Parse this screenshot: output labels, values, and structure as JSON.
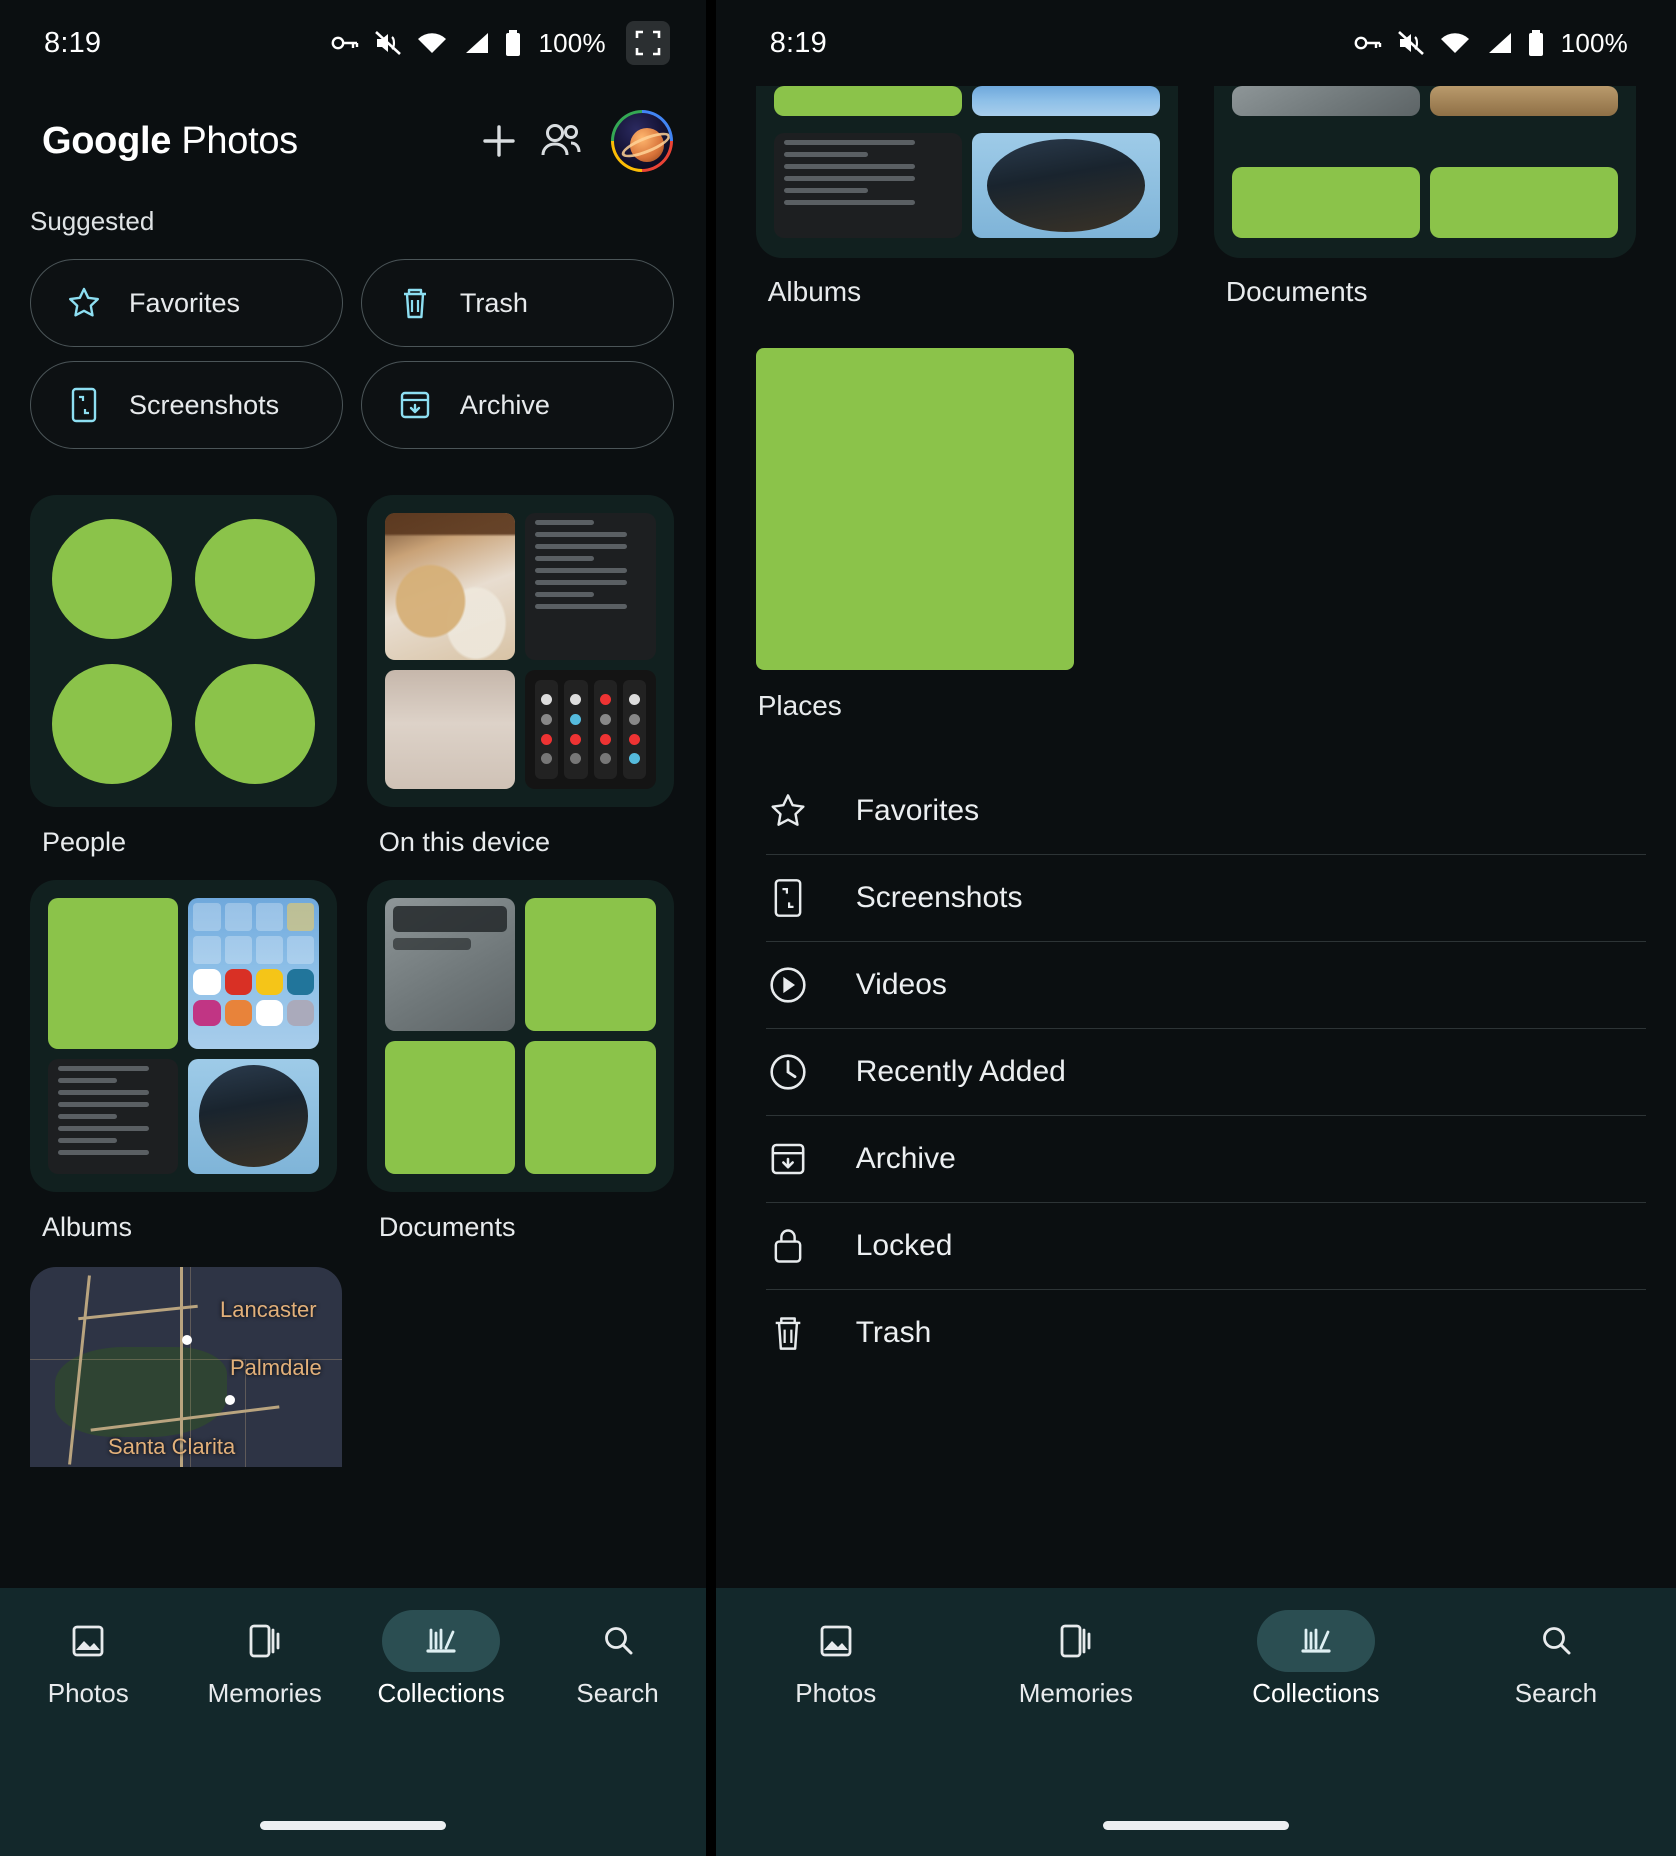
{
  "left": {
    "status": {
      "time": "8:19",
      "battery_pct": "100%",
      "icons": [
        "key-icon",
        "mute-icon",
        "wifi-icon",
        "signal-icon",
        "battery-icon"
      ],
      "fullscreen_icon": "fullscreen-icon"
    },
    "appbar": {
      "brand_bold": "Google",
      "brand_thin": " Photos",
      "add_icon": "plus-icon",
      "sharing_icon": "people-icon",
      "avatar_icon": "account-avatar"
    },
    "suggested": {
      "label": "Suggested",
      "chips": [
        {
          "label": "Favorites",
          "icon": "star-icon"
        },
        {
          "label": "Trash",
          "icon": "trash-icon"
        },
        {
          "label": "Screenshots",
          "icon": "screenshot-icon"
        },
        {
          "label": "Archive",
          "icon": "archive-icon"
        }
      ]
    },
    "tiles": [
      {
        "caption": "People",
        "kind": "people"
      },
      {
        "caption": "On this device",
        "kind": "device"
      },
      {
        "caption": "Albums",
        "kind": "albums"
      },
      {
        "caption": "Documents",
        "kind": "documents"
      }
    ],
    "map": {
      "labels": [
        "Lancaster",
        "Palmdale",
        "Santa Clarita"
      ]
    },
    "bottomnav": {
      "items": [
        {
          "label": "Photos",
          "icon": "photos-icon",
          "active": false
        },
        {
          "label": "Memories",
          "icon": "memories-icon",
          "active": false
        },
        {
          "label": "Collections",
          "icon": "collections-icon",
          "active": true
        },
        {
          "label": "Search",
          "icon": "search-icon",
          "active": false
        }
      ]
    }
  },
  "right": {
    "status": {
      "time": "8:19",
      "battery_pct": "100%"
    },
    "tiles": [
      {
        "caption": "Albums"
      },
      {
        "caption": "Documents"
      }
    ],
    "places": {
      "caption": "Places"
    },
    "list": [
      {
        "label": "Favorites",
        "icon": "star-icon"
      },
      {
        "label": "Screenshots",
        "icon": "screenshot-icon"
      },
      {
        "label": "Videos",
        "icon": "play-circle-icon"
      },
      {
        "label": "Recently Added",
        "icon": "clock-icon"
      },
      {
        "label": "Archive",
        "icon": "archive-icon"
      },
      {
        "label": "Locked",
        "icon": "lock-icon"
      },
      {
        "label": "Trash",
        "icon": "trash-icon"
      }
    ],
    "bottomnav": {
      "items": [
        {
          "label": "Photos",
          "icon": "photos-icon",
          "active": false
        },
        {
          "label": "Memories",
          "icon": "memories-icon",
          "active": false
        },
        {
          "label": "Collections",
          "icon": "collections-icon",
          "active": true
        },
        {
          "label": "Search",
          "icon": "search-icon",
          "active": false
        }
      ]
    }
  },
  "colors": {
    "background": "#0b0f11",
    "tile_bg": "#11201f",
    "accent_cyan": "#8ddff2",
    "placeholder_green": "#8bc34a",
    "nav_bg": "#13282b",
    "nav_pill": "#2b4e52"
  }
}
